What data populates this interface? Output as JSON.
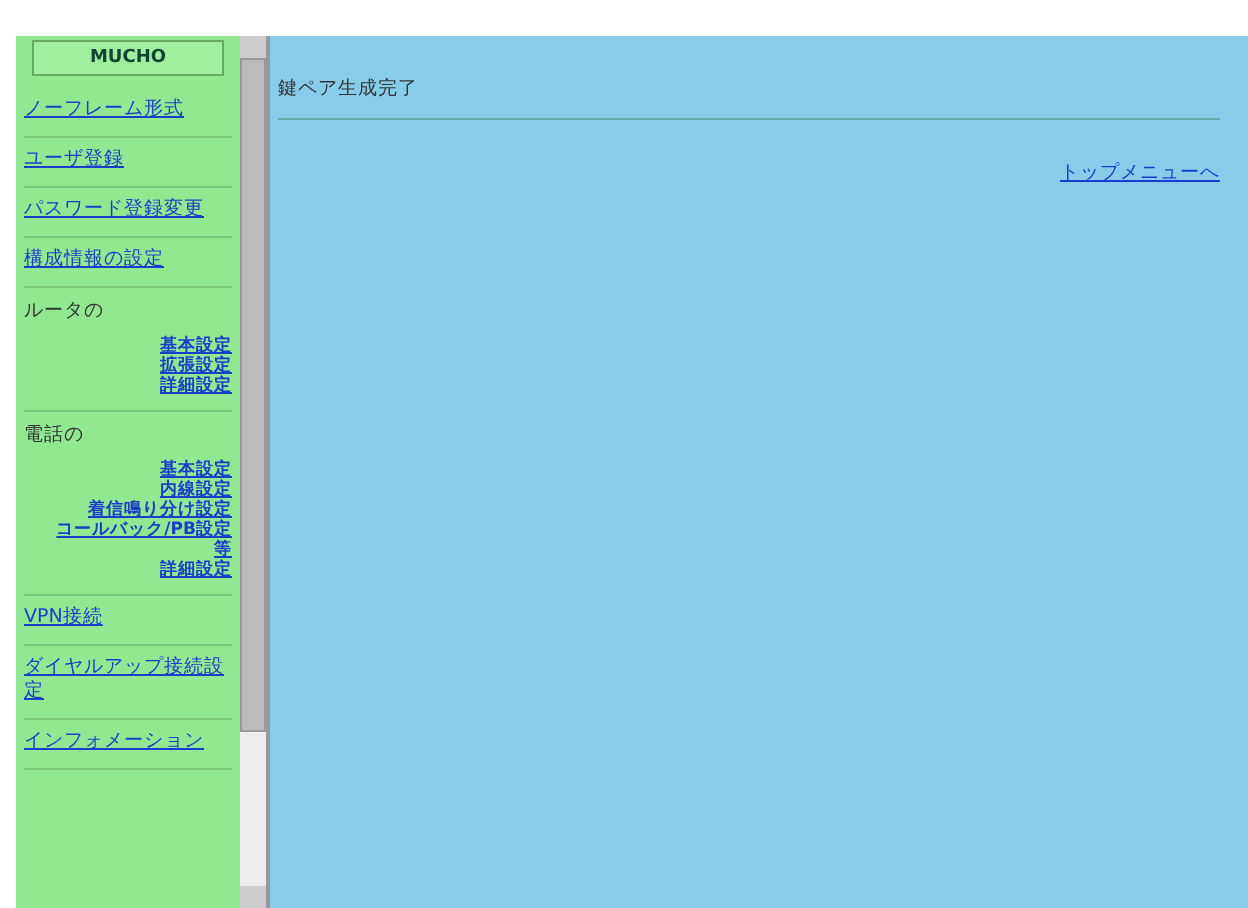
{
  "sidebar": {
    "logo": "MUCHO",
    "items": [
      {
        "kind": "link",
        "label": "ノーフレーム形式"
      },
      {
        "kind": "link",
        "label": "ユーザ登録"
      },
      {
        "kind": "link",
        "label": "パスワード登録変更"
      },
      {
        "kind": "link",
        "label": "構成情報の設定"
      },
      {
        "kind": "group",
        "label": "ルータの",
        "children": [
          "基本設定",
          "拡張設定",
          "詳細設定"
        ]
      },
      {
        "kind": "group",
        "label": "電話の",
        "children": [
          "基本設定",
          "内線設定",
          "着信鳴り分け設定",
          "コールバック/PB設定",
          "等",
          "詳細設定"
        ]
      },
      {
        "kind": "link",
        "label": "VPN接続"
      },
      {
        "kind": "link",
        "label": "ダイヤルアップ接続設定"
      },
      {
        "kind": "link",
        "label": "インフォメーション"
      }
    ]
  },
  "main": {
    "message": "鍵ペア生成完了",
    "link": "トップメニューへ"
  }
}
